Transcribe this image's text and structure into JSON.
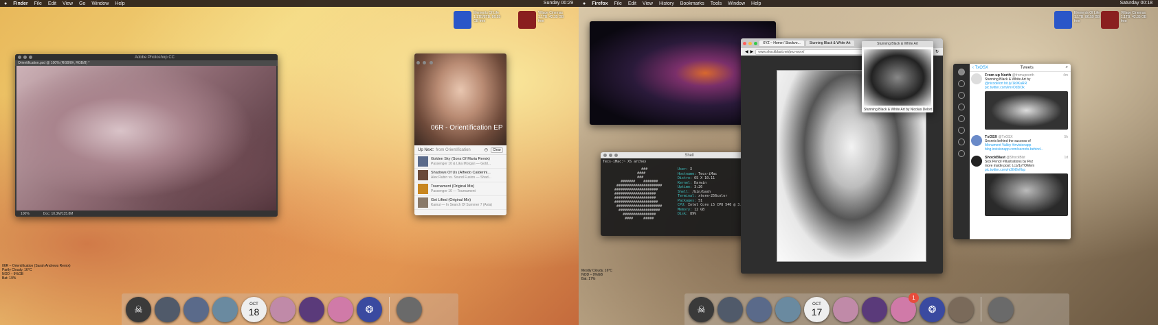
{
  "left": {
    "menu": {
      "app": "Finder",
      "items": [
        "File",
        "Edit",
        "View",
        "Go",
        "Window",
        "Help"
      ],
      "clock": "Sunday 00:29"
    },
    "desktop_icons": [
      {
        "label": "Elements Of Life",
        "sub": "1.1TB/8TB, 86.59 GB free",
        "color": "#2a56c8"
      },
      {
        "label": "Village Cinemas",
        "sub": "1.1TB, 42.35 GB free",
        "color": "#8a1f1f"
      }
    ],
    "photoshop": {
      "title": "Adobe Photoshop CC",
      "doc_tab": "Orientification.psd @ 100% (RGB/8#, RGB/8) *",
      "zoom": "100%",
      "doc_size": "Doc: 10.3M/135.8M"
    },
    "music": {
      "album": "06R - Orientification EP",
      "up_next": "Up Next:",
      "from": "from Orientification",
      "clear": "Clear",
      "tracks": [
        {
          "title": "Golden Sky (Sons Of Maria Remix)",
          "sub": "Passenger 10 & Lika Morgan — Gold..."
        },
        {
          "title": "Shadows Of Us (Alfredo Calderini...",
          "sub": "Alex Rubin vs. Sound Fusion — Shad..."
        },
        {
          "title": "Tournament (Original Mix)",
          "sub": "Passenger 10 — Tournament"
        },
        {
          "title": "Get Lifted (Original Mix)",
          "sub": "Kamui — In Search Of Summer 7 (Axia)"
        }
      ]
    },
    "hud": [
      "06R – Orientification (Sarah Andrews Remix)",
      "Partly Cloudy, 16°C",
      "NOD – 9%GB",
      "Bat: 19%"
    ],
    "dock": [
      {
        "name": "skull-app",
        "color": "#3a3a3a"
      },
      {
        "name": "bird-app",
        "color": "#505a6a"
      },
      {
        "name": "cloud-app",
        "color": "#5a6a8a"
      },
      {
        "name": "sky-app",
        "color": "#6a8aa0"
      },
      {
        "name": "calendar",
        "month": "OCT",
        "day": "18"
      },
      {
        "name": "sunset-app",
        "color": "#c08aa8"
      },
      {
        "name": "nebula-app",
        "color": "#5a3a7a"
      },
      {
        "name": "pink-app",
        "color": "#d07aa8"
      },
      {
        "name": "sphere-app",
        "color": "#3a4aa0"
      },
      {
        "name": "moon-app",
        "color": "#6a6a6a"
      }
    ]
  },
  "right": {
    "menu": {
      "app": "Firefox",
      "items": [
        "File",
        "Edit",
        "View",
        "History",
        "Bookmarks",
        "Tools",
        "Window",
        "Help"
      ],
      "clock": "Saturday 00:18"
    },
    "desktop_icons": [
      {
        "label": "Elements Of Life",
        "sub": "1.1TB, 86.59 GB free",
        "color": "#2a56c8"
      },
      {
        "label": "Village Cinemas",
        "sub": "1.1TB, 42.35 GB free",
        "color": "#8a1f1f"
      }
    ],
    "shell": {
      "title": "Shell",
      "prompt": "Tecs-iMac:~ XS archey",
      "logo": "                 ###\n               ####\n               ###\n       #######    #######\n     ######################\n    #####################\n    ####################\n    ####################\n    #####################\n     ######################\n      ####################\n        ################\n         ####     #####",
      "info": [
        {
          "k": "User:",
          "v": "X"
        },
        {
          "k": "Hostname:",
          "v": "Tecs-iMac"
        },
        {
          "k": "Distro:",
          "v": "OS X 10.11"
        },
        {
          "k": "Kernel:",
          "v": "Darwin"
        },
        {
          "k": "Uptime:",
          "v": "3:26"
        },
        {
          "k": "Shell:",
          "v": "/bin/bash"
        },
        {
          "k": "Terminal:",
          "v": "xterm-256color"
        },
        {
          "k": "Packages:",
          "v": "51"
        },
        {
          "k": "CPU:",
          "v": "Intel Core i5 CPU 540 @ 3.07GHz"
        },
        {
          "k": "Memory:",
          "v": "12 GB"
        },
        {
          "k": "Disk:",
          "v": "89%"
        }
      ]
    },
    "browser": {
      "tabs": [
        "XYZ – Home / Stockvo...",
        "Stunning Black & White Art"
      ],
      "url": "www.shockblast.net/pez-worx/"
    },
    "preview": {
      "title": "Stunning Black & White Art",
      "caption": "Stunning Black & White Art by Nicolas Delort |"
    },
    "tweets": {
      "back": "TxOSX",
      "title": "Tweets",
      "items": [
        {
          "name": "From up North",
          "handle": "@fromupnorth",
          "age": "4m",
          "lines": [
            "Stunning Black & White Art by",
            "@nicodelort bit.ly/1k9KaRR",
            "pic.twitter.com/imvOd3iOk"
          ],
          "media": true
        },
        {
          "name": "TxOSX",
          "handle": "@TxOSX",
          "age": "5h",
          "lines": [
            "Secrets behind the success of",
            "Monument Valley #invisionapp",
            "blog.invisionapp.com/secrets-behind..."
          ],
          "media": false
        },
        {
          "name": "ShockBlast",
          "handle": "@ShockBlst",
          "age": "1d",
          "lines": [
            "Sick Pencil #illustrations by Pez",
            "",
            "more inside post: t.co/1yTOMem",
            "pic.twitter.com/m2tN6vNsp"
          ],
          "media": true
        }
      ]
    },
    "hud": [
      "Mostly Cloudy, 16°C",
      "NOD – 9%GB",
      "Bat: 17%"
    ],
    "dock": [
      {
        "name": "skull-app",
        "color": "#3a3a3a"
      },
      {
        "name": "bird-app",
        "color": "#505a6a"
      },
      {
        "name": "cloud-app",
        "color": "#5a6a8a"
      },
      {
        "name": "sky-app",
        "color": "#6a8aa0"
      },
      {
        "name": "calendar",
        "month": "OCT",
        "day": "17"
      },
      {
        "name": "sunset-app",
        "color": "#c08aa8"
      },
      {
        "name": "nebula-app",
        "color": "#5a3a7a"
      },
      {
        "name": "pink-app",
        "color": "#d07aa8",
        "badge": "1"
      },
      {
        "name": "sphere-app",
        "color": "#3a4aa0"
      },
      {
        "name": "owl-app",
        "color": "#7a6a5a"
      },
      {
        "name": "moon-app",
        "color": "#6a6a6a"
      }
    ]
  }
}
